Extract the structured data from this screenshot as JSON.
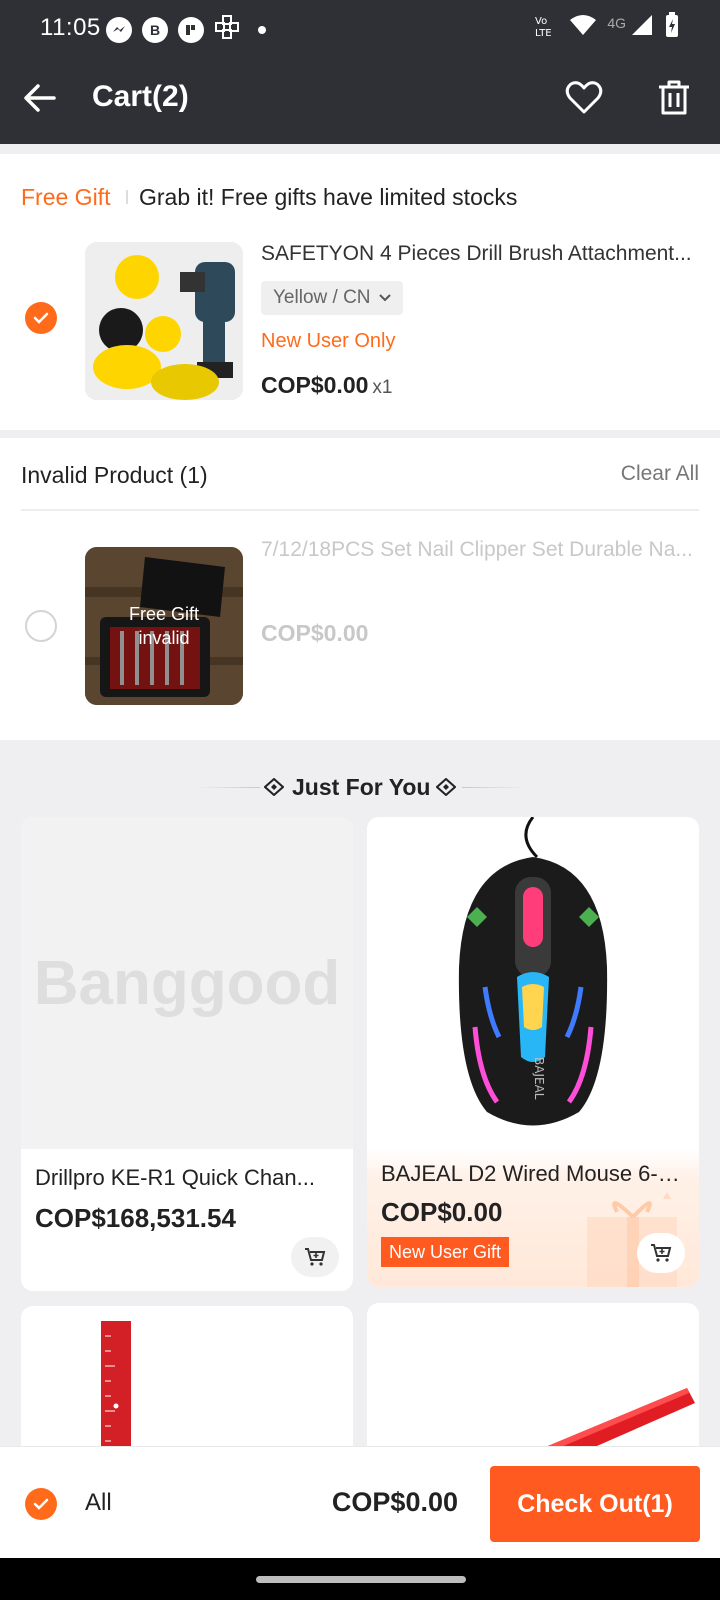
{
  "status_bar": {
    "time": "11:05",
    "network": "4G",
    "lte": "Vo LTE"
  },
  "header": {
    "title": "Cart(2)"
  },
  "gift_section": {
    "tag": "Free Gift",
    "message": "Grab it! Free gifts have limited stocks",
    "item": {
      "title": "SAFETYON 4 Pieces Drill Brush Attachment...",
      "variant": "Yellow / CN",
      "promo": "New User Only",
      "price": "COP$0.00",
      "qty": "x1",
      "checked": true
    }
  },
  "invalid_section": {
    "heading": "Invalid Product (1)",
    "clear_all": "Clear All",
    "item": {
      "title": "7/12/18PCS Set Nail Clipper Set Durable Na...",
      "overlay_line1": "Free Gift",
      "overlay_line2": "invalid",
      "price": "COP$0.00"
    }
  },
  "just_for_you": {
    "title": "Just For You",
    "products": [
      {
        "title": "Drillpro KE-R1 Quick Chan...",
        "price": "COP$168,531.54",
        "placeholder": "Banggood"
      },
      {
        "title": "BAJEAL D2 Wired Mouse 6-Bu...",
        "price": "COP$0.00",
        "badge": "New User Gift",
        "brand_mark": "BAJEAL"
      }
    ]
  },
  "bottom_bar": {
    "all_label": "All",
    "total": "COP$0.00",
    "checkout": "Check Out(1)"
  },
  "colors": {
    "accent": "#ff6b1a",
    "header_bg": "#2f3035",
    "checkout_bg": "#ff5a1f"
  }
}
